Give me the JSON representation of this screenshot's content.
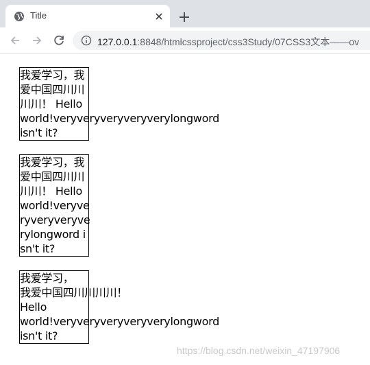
{
  "browser": {
    "tab_title": "Title",
    "url_host": "127.0.0.1",
    "url_rest": ":8848/htmlcssproject/css3Study/07CSS3文本——ov"
  },
  "boxes": [
    {
      "lines": [
        "我爱学习，我",
        "爱中国四川川",
        "川川！ Hello",
        "world!veryveryveryveryverylongword",
        "isn't it?"
      ]
    },
    {
      "lines": [
        "我爱学习，我",
        "爱中国四川川",
        "川川！ Hello",
        "world!veryve",
        "ryveryveryve",
        "rylongword i",
        "sn't it?"
      ]
    },
    {
      "lines": [
        "我爱学习，",
        "我爱中国四川川川川！",
        "Hello",
        "world!veryveryveryveryverylongword",
        "isn't it?"
      ]
    }
  ],
  "watermark": "https://blog.csdn.net/weixin_47197906"
}
